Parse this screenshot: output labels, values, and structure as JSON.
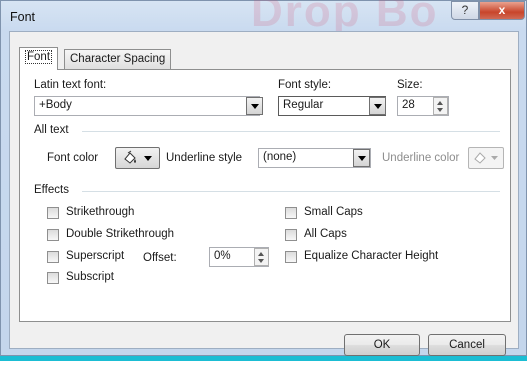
{
  "window": {
    "title": "Font",
    "watermark": "Drop Bo",
    "help_label": "?",
    "close_label": "x"
  },
  "tabs": [
    {
      "label": "Font"
    },
    {
      "label": "Character Spacing"
    }
  ],
  "latin_font": {
    "label": "Latin text font:",
    "value": "+Body"
  },
  "font_style": {
    "label": "Font style:",
    "value": "Regular"
  },
  "size": {
    "label": "Size:",
    "value": "28"
  },
  "all_text": {
    "title": "All text",
    "font_color_label": "Font color",
    "underline_style_label": "Underline style",
    "underline_style_value": "(none)",
    "underline_color_label": "Underline color"
  },
  "effects": {
    "title": "Effects",
    "left": [
      {
        "label": "Strikethrough",
        "checked": false
      },
      {
        "label": "Double Strikethrough",
        "checked": false
      },
      {
        "label": "Superscript",
        "checked": false
      },
      {
        "label": "Subscript",
        "checked": false
      }
    ],
    "right": [
      {
        "label": "Small Caps",
        "checked": false
      },
      {
        "label": "All Caps",
        "checked": false
      },
      {
        "label": "Equalize Character Height",
        "checked": false
      }
    ],
    "offset_label": "Offset:",
    "offset_value": "0%"
  },
  "buttons": {
    "ok": "OK",
    "cancel": "Cancel"
  },
  "colors": {
    "accent_bar": "#1bbdd3",
    "dialog_bg": "#f0f0f0",
    "frame": "#c9daef"
  },
  "icons": {
    "font_color": "paint-bucket-icon",
    "underline_color": "paint-bucket-icon"
  }
}
